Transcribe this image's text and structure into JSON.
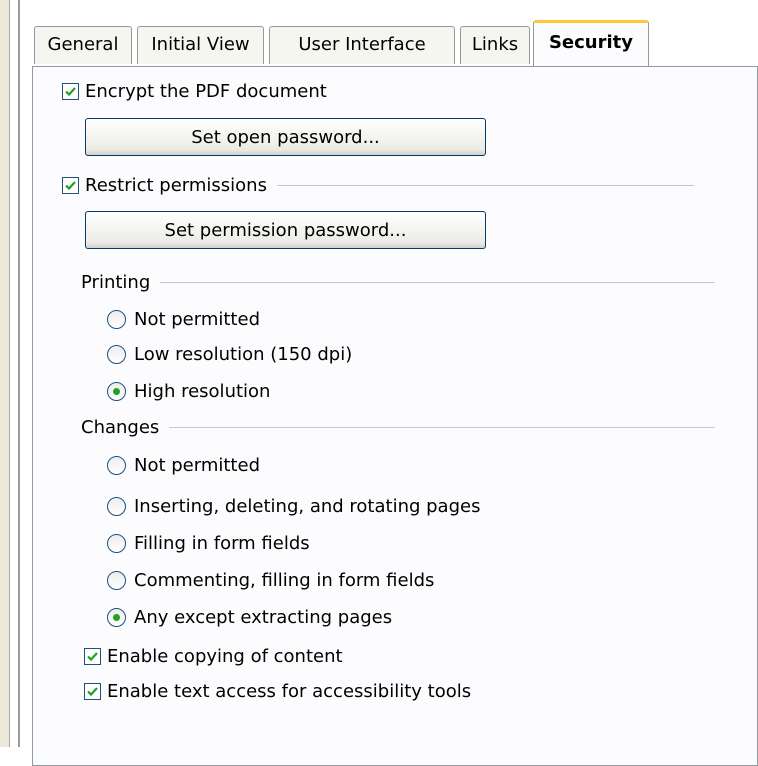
{
  "tabs": [
    {
      "label": "General"
    },
    {
      "label": "Initial View"
    },
    {
      "label": "User Interface"
    },
    {
      "label": "Links"
    },
    {
      "label": "Security"
    }
  ],
  "encrypt": {
    "label": "Encrypt the PDF document",
    "checked": true
  },
  "open_password_button": "Set open password...",
  "restrict": {
    "label": "Restrict permissions",
    "checked": true
  },
  "permission_password_button": "Set permission password...",
  "printing": {
    "header": "Printing",
    "options": [
      {
        "label": "Not permitted",
        "selected": false
      },
      {
        "label": "Low resolution (150 dpi)",
        "selected": false
      },
      {
        "label": "High resolution",
        "selected": true
      }
    ]
  },
  "changes": {
    "header": "Changes",
    "options": [
      {
        "label": "Not permitted",
        "selected": false
      },
      {
        "label": "Inserting, deleting, and rotating pages",
        "selected": false
      },
      {
        "label": "Filling in form fields",
        "selected": false
      },
      {
        "label": "Commenting, filling in form fields",
        "selected": false
      },
      {
        "label": "Any except extracting pages",
        "selected": true
      }
    ]
  },
  "copy_content": {
    "label": "Enable copying of content",
    "checked": true
  },
  "text_access": {
    "label": "Enable text access for accessibility tools",
    "checked": true
  },
  "colors": {
    "check": "#21a121",
    "tab_highlight": "#ffc83c",
    "border": "#919b9c"
  }
}
